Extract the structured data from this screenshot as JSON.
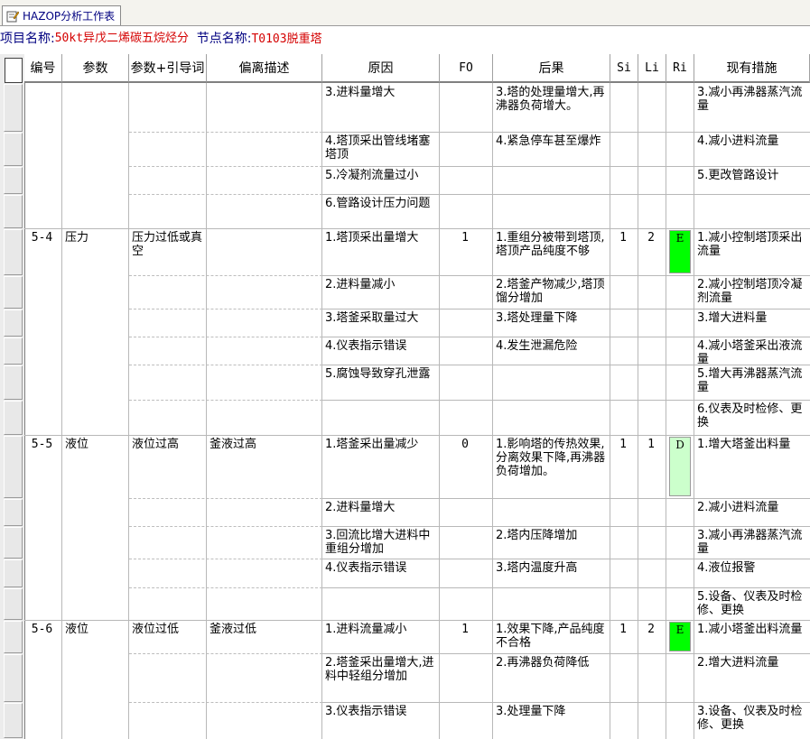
{
  "tab": {
    "label": "HAZOP分析工作表"
  },
  "info": {
    "project_label": "项目名称:",
    "project_value": "50kt异戊二烯碳五烷烃分",
    "node_label": "节点名称:",
    "node_value": "T0103脱重塔"
  },
  "headers": [
    "编号",
    "参数",
    "参数+引导词",
    "偏离描述",
    "原因",
    "FO",
    "后果",
    "Si",
    "Li",
    "Ri",
    "现有措施"
  ],
  "colors": {
    "risk_E": "#00ff00",
    "risk_D": "#ccffcc",
    "project_text": "#d40000",
    "label_text": "#000080"
  },
  "rows": [
    {
      "id": "",
      "param": "",
      "guide": "",
      "dev": "",
      "cause": "3.进料量增大",
      "fo": "",
      "cons": "3.塔的处理量增大,再沸器负荷增大。",
      "si": "",
      "li": "",
      "ri": "",
      "meas": "3.减小再沸器蒸汽流量"
    },
    {
      "id": "",
      "param": "",
      "guide": "",
      "dev": "",
      "cause": "4.塔顶采出管线堵塞塔顶",
      "fo": "",
      "cons": "4.紧急停车甚至爆炸",
      "si": "",
      "li": "",
      "ri": "",
      "meas": "4.减小进料流量"
    },
    {
      "id": "",
      "param": "",
      "guide": "",
      "dev": "",
      "cause": "5.冷凝剂流量过小",
      "fo": "",
      "cons": "",
      "si": "",
      "li": "",
      "ri": "",
      "meas": "5.更改管路设计"
    },
    {
      "id": "",
      "param": "",
      "guide": "",
      "dev": "",
      "cause": "6.管路设计压力问题",
      "fo": "",
      "cons": "",
      "si": "",
      "li": "",
      "ri": "",
      "meas": ""
    },
    {
      "id": "5-4",
      "param": "压力",
      "guide": "压力过低或真空",
      "dev": "",
      "cause": "1.塔顶采出量增大",
      "fo": "1",
      "cons": "1.重组分被带到塔顶,塔顶产品纯度不够",
      "si": "1",
      "li": "2",
      "ri": "E",
      "meas": "1.减小控制塔顶采出流量"
    },
    {
      "id": "",
      "param": "",
      "guide": "",
      "dev": "",
      "cause": "2.进料量减小",
      "fo": "",
      "cons": "2.塔釜产物减少,塔顶馏分增加",
      "si": "",
      "li": "",
      "ri": "",
      "meas": "2.减小控制塔顶冷凝剂流量"
    },
    {
      "id": "",
      "param": "",
      "guide": "",
      "dev": "",
      "cause": "3.塔釜采取量过大",
      "fo": "",
      "cons": "3.塔处理量下降",
      "si": "",
      "li": "",
      "ri": "",
      "meas": "3.增大进料量"
    },
    {
      "id": "",
      "param": "",
      "guide": "",
      "dev": "",
      "cause": "4.仪表指示错误",
      "fo": "",
      "cons": "4.发生泄漏危险",
      "si": "",
      "li": "",
      "ri": "",
      "meas": "4.减小塔釜采出液流量"
    },
    {
      "id": "",
      "param": "",
      "guide": "",
      "dev": "",
      "cause": "5.腐蚀导致穿孔泄露",
      "fo": "",
      "cons": "",
      "si": "",
      "li": "",
      "ri": "",
      "meas": "5.增大再沸器蒸汽流量"
    },
    {
      "id": "",
      "param": "",
      "guide": "",
      "dev": "",
      "cause": "",
      "fo": "",
      "cons": "",
      "si": "",
      "li": "",
      "ri": "",
      "meas": "6.仪表及时检修、更换"
    },
    {
      "id": "5-5",
      "param": "液位",
      "guide": "液位过高",
      "dev": "釜液过高",
      "cause": "1.塔釜采出量减少",
      "fo": "0",
      "cons": "1.影响塔的传热效果,分离效果下降,再沸器负荷增加。",
      "si": "1",
      "li": "1",
      "ri": "D",
      "meas": "1.增大塔釜出料量"
    },
    {
      "id": "",
      "param": "",
      "guide": "",
      "dev": "",
      "cause": "2.进料量增大",
      "fo": "",
      "cons": "",
      "si": "",
      "li": "",
      "ri": "",
      "meas": "2.减小进料流量"
    },
    {
      "id": "",
      "param": "",
      "guide": "",
      "dev": "",
      "cause": "3.回流比增大进料中重组分增加",
      "fo": "",
      "cons": "2.塔内压降增加",
      "si": "",
      "li": "",
      "ri": "",
      "meas": "3.减小再沸器蒸汽流量"
    },
    {
      "id": "",
      "param": "",
      "guide": "",
      "dev": "",
      "cause": "4.仪表指示错误",
      "fo": "",
      "cons": "3.塔内温度升高",
      "si": "",
      "li": "",
      "ri": "",
      "meas": "4.液位报警"
    },
    {
      "id": "",
      "param": "",
      "guide": "",
      "dev": "",
      "cause": "",
      "fo": "",
      "cons": "",
      "si": "",
      "li": "",
      "ri": "",
      "meas": "5.设备、仪表及时检修、更换"
    },
    {
      "id": "5-6",
      "param": "液位",
      "guide": "液位过低",
      "dev": "釜液过低",
      "cause": "1.进料流量减小",
      "fo": "1",
      "cons": "1.效果下降,产品纯度不合格",
      "si": "1",
      "li": "2",
      "ri": "E",
      "meas": "1.减小塔釜出料流量"
    },
    {
      "id": "",
      "param": "",
      "guide": "",
      "dev": "",
      "cause": "2.塔釜采出量增大,进料中轻组分增加",
      "fo": "",
      "cons": "2.再沸器负荷降低",
      "si": "",
      "li": "",
      "ri": "",
      "meas": "2.增大进料流量"
    },
    {
      "id": "",
      "param": "",
      "guide": "",
      "dev": "",
      "cause": "3.仪表指示错误",
      "fo": "",
      "cons": "3.处理量下降",
      "si": "",
      "li": "",
      "ri": "",
      "meas": "3.设备、仪表及时检修、更换"
    }
  ]
}
